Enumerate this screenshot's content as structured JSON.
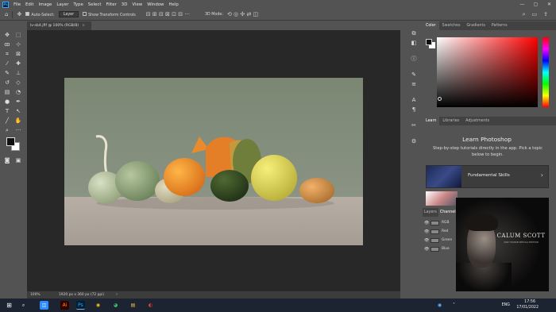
{
  "menubar": {
    "logo": "Ps",
    "items": [
      "File",
      "Edit",
      "Image",
      "Layer",
      "Type",
      "Select",
      "Filter",
      "3D",
      "View",
      "Window",
      "Help"
    ],
    "window_controls": [
      "—",
      "▢",
      "✕"
    ]
  },
  "options": {
    "auto_select_label": "Auto-Select:",
    "auto_select_value": "Layer",
    "show_transform_label": "Show Transform Controls",
    "mode_label": "3D Mode:"
  },
  "document": {
    "tab_title": "lv-sb4.jfif @ 100% (RGB/8)",
    "zoom": "100%",
    "dimensions": "1920 px x 360 px (72 ppi)"
  },
  "color_panel": {
    "tabs": [
      "Color",
      "Swatches",
      "Gradients",
      "Patterns"
    ]
  },
  "learn_panel": {
    "tabs": [
      "Learn",
      "Libraries",
      "Adjustments"
    ],
    "title": "Learn Photoshop",
    "subtitle": "Step-by-step tutorials directly in the app. Pick a topic below to begin.",
    "card_label": "Fundamental Skills"
  },
  "layers_panel": {
    "tabs": [
      "Layers",
      "Channels"
    ],
    "channels": [
      "RGB",
      "Red",
      "Green",
      "Blue"
    ]
  },
  "popup": {
    "artist": "CALUM SCOTT",
    "subtitle": "ONLY HUMAN SPECIAL EDITION"
  },
  "taskbar": {
    "time": "17:56",
    "date": "17/01/2022",
    "lang": "ENG",
    "apps": [
      "⊞",
      "⌕",
      "◫",
      "▦",
      "Ai",
      "Ps",
      "◉",
      "◕",
      "▤",
      "◐"
    ]
  },
  "colors": {
    "accent": "#31a8ff",
    "panel": "#535353",
    "canvas_bg": "#282828",
    "taskbar": "#1d2431"
  }
}
